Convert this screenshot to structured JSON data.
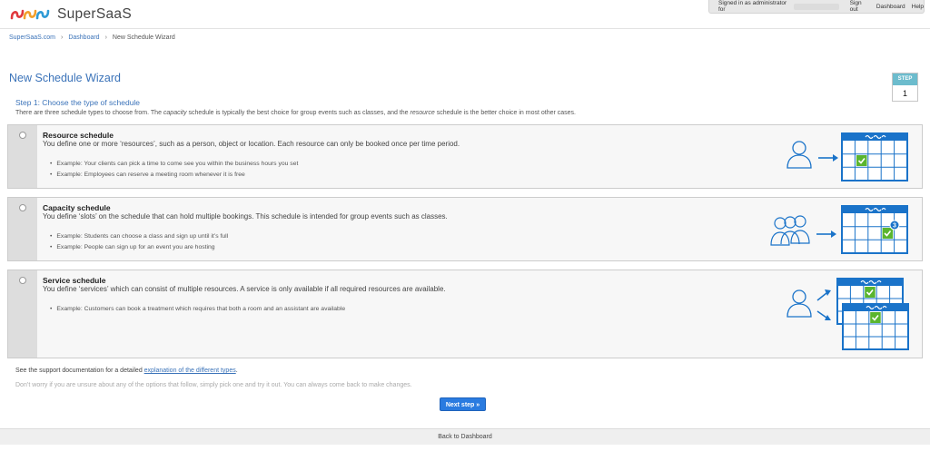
{
  "header": {
    "brand": "SuperSaaS",
    "signed_in_text": "Signed in as administrator for",
    "sign_out": "Sign out",
    "dashboard": "Dashboard",
    "help": "Help"
  },
  "breadcrumb": {
    "home": "SuperSaaS.com",
    "dashboard": "Dashboard",
    "current": "New Schedule Wizard",
    "separator": "›"
  },
  "page": {
    "title": "New Schedule Wizard",
    "step_label": "STEP",
    "step_number": "1",
    "step_heading": "Step 1: Choose the type of schedule",
    "intro": {
      "part1": "There are three schedule types to choose from. The ",
      "capacity_word": "capacity",
      "part2": " schedule is typically the best choice for group events such as classes, and the ",
      "resource_word": "resource",
      "part3": " schedule is the better choice in most other cases."
    }
  },
  "options": [
    {
      "title": "Resource schedule",
      "description": "You define one or more ‘resources’, such as a person, object or location. Each resource can only be booked once per time period.",
      "examples": [
        "Example: Your clients can pick a time to come see you within the business hours you set",
        "Example: Employees can reserve a meeting room whenever it is free"
      ],
      "icon": "single-person-calendar-icon"
    },
    {
      "title": "Capacity schedule",
      "description": "You define ‘slots’ on the schedule that can hold multiple bookings. This schedule is intended for group events such as classes.",
      "examples": [
        "Example: Students can choose a class and sign up until it’s full",
        "Example: People can sign up for an event you are hosting"
      ],
      "badge": "3",
      "icon": "group-calendar-icon"
    },
    {
      "title": "Service schedule",
      "description": "You define ‘services’ which can consist of multiple resources. A service is only available if all required resources are available.",
      "examples": [
        "Example: Customers can book a treatment which requires that both a room and an assistant are available"
      ],
      "icon": "person-two-calendars-icon"
    }
  ],
  "support": {
    "prefix": "See the support documentation for a detailed ",
    "link": "explanation of the different types",
    "suffix": "."
  },
  "hint": "Don’t worry if you are unsure about any of the options that follow, simply pick one and try it out. You can always come back to make changes.",
  "next_button": "Next step »",
  "footer": "Back to Dashboard",
  "colors": {
    "accent": "#3b73b9",
    "button": "#2a7be0",
    "calendar_blue": "#1a73c9",
    "check_green": "#5ab52e",
    "step_teal": "#6cbccd"
  }
}
